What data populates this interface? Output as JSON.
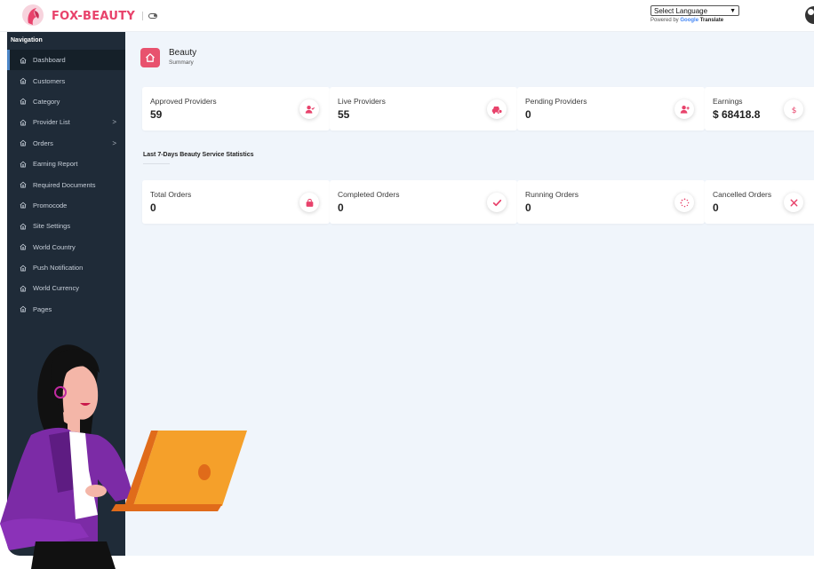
{
  "brand": {
    "name": "FOX-BEAUTY",
    "accent": "#e8426b"
  },
  "language": {
    "selected": "Select Language",
    "powered_by": "Powered by",
    "google": "Google",
    "translate": "Translate"
  },
  "sidebar": {
    "title": "Navigation",
    "items": [
      {
        "label": "Dashboard",
        "icon": "home-icon",
        "active": true
      },
      {
        "label": "Customers",
        "icon": "home-icon"
      },
      {
        "label": "Category",
        "icon": "home-icon"
      },
      {
        "label": "Provider List",
        "icon": "home-icon",
        "chevron": ">"
      },
      {
        "label": "Orders",
        "icon": "home-icon",
        "chevron": ">"
      },
      {
        "label": "Earning Report",
        "icon": "home-icon"
      },
      {
        "label": "Required Documents",
        "icon": "home-icon"
      },
      {
        "label": "Promocode",
        "icon": "home-icon"
      },
      {
        "label": "Site Settings",
        "icon": "home-icon"
      },
      {
        "label": "World Country",
        "icon": "home-icon"
      },
      {
        "label": "Push Notification",
        "icon": "home-icon"
      },
      {
        "label": "World Currency",
        "icon": "home-icon"
      },
      {
        "label": "Pages",
        "icon": "home-icon"
      }
    ]
  },
  "header": {
    "title": "Beauty",
    "subtitle": "Summary"
  },
  "summary_cards": [
    {
      "label": "Approved Providers",
      "value": "59",
      "icon": "user-check-icon"
    },
    {
      "label": "Live Providers",
      "value": "55",
      "icon": "car-icon"
    },
    {
      "label": "Pending Providers",
      "value": "0",
      "icon": "user-plus-icon"
    },
    {
      "label": "Earnings",
      "value": "$ 68418.8",
      "icon": "dollar-icon"
    }
  ],
  "stats": {
    "title": "Last 7-Days Beauty Service Statistics"
  },
  "order_cards": [
    {
      "label": "Total Orders",
      "value": "0",
      "icon": "shopping-bag-icon"
    },
    {
      "label": "Completed Orders",
      "value": "0",
      "icon": "check-icon"
    },
    {
      "label": "Running Orders",
      "value": "0",
      "icon": "spinner-icon"
    },
    {
      "label": "Cancelled Orders",
      "value": "0",
      "icon": "cancel-icon"
    }
  ]
}
